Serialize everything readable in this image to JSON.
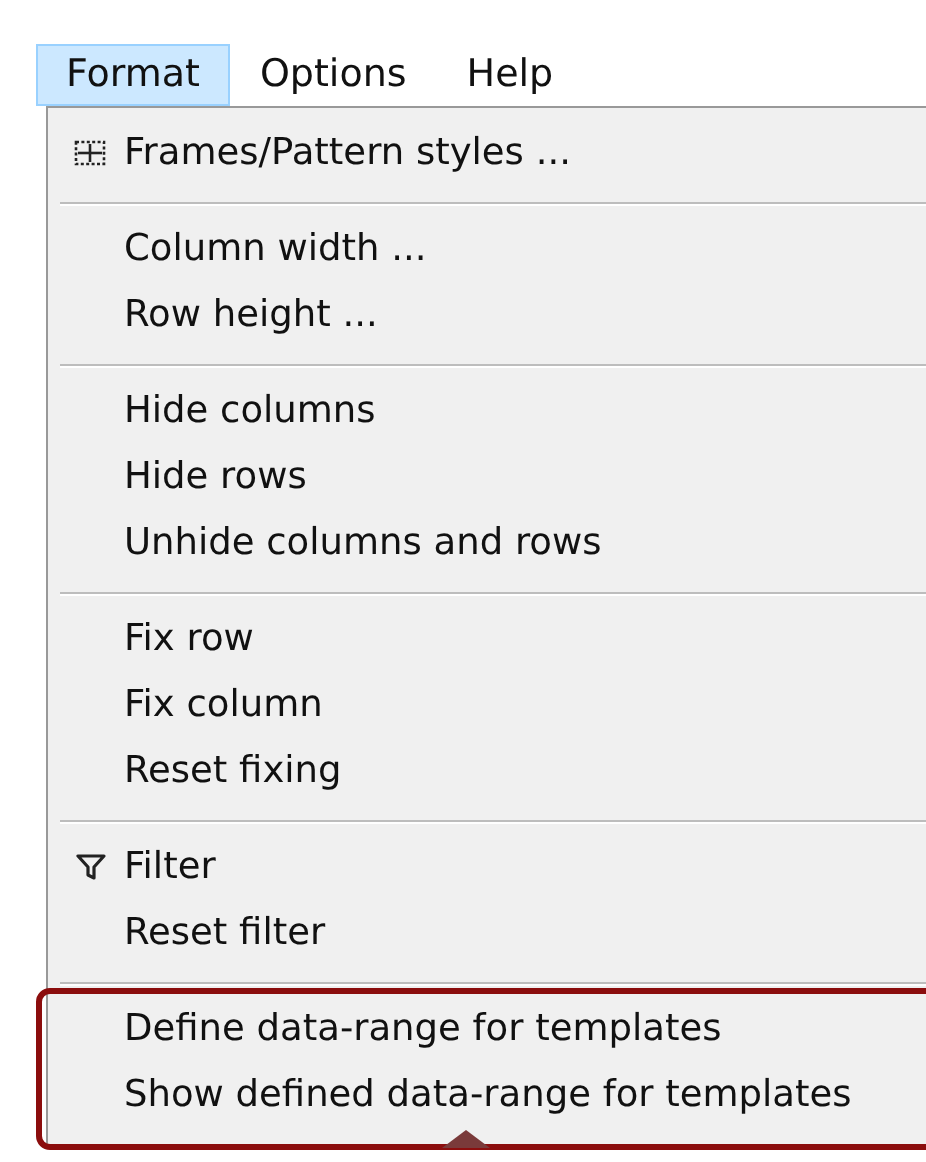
{
  "menubar": [
    {
      "label": "Format",
      "selected": true
    },
    {
      "label": "Options",
      "selected": false
    },
    {
      "label": "Help",
      "selected": false
    }
  ],
  "menu": {
    "groups": [
      {
        "highlighted": false,
        "items": [
          {
            "label": "Frames/Pattern styles ...",
            "kind": "frames"
          }
        ]
      },
      {
        "highlighted": false,
        "items": [
          {
            "label": "Column width ..."
          },
          {
            "label": "Row height ..."
          }
        ]
      },
      {
        "highlighted": false,
        "items": [
          {
            "label": "Hide columns"
          },
          {
            "label": "Hide rows"
          },
          {
            "label": "Unhide columns and rows"
          }
        ]
      },
      {
        "highlighted": false,
        "items": [
          {
            "label": "Fix row"
          },
          {
            "label": "Fix column"
          },
          {
            "label": "Reset fixing"
          }
        ]
      },
      {
        "highlighted": false,
        "items": [
          {
            "label": "Filter",
            "kind": "filter"
          },
          {
            "label": "Reset filter"
          }
        ]
      },
      {
        "highlighted": true,
        "items": [
          {
            "label": "Define data-range for templates"
          },
          {
            "label": "Show defined data-range for templates"
          }
        ]
      }
    ]
  }
}
